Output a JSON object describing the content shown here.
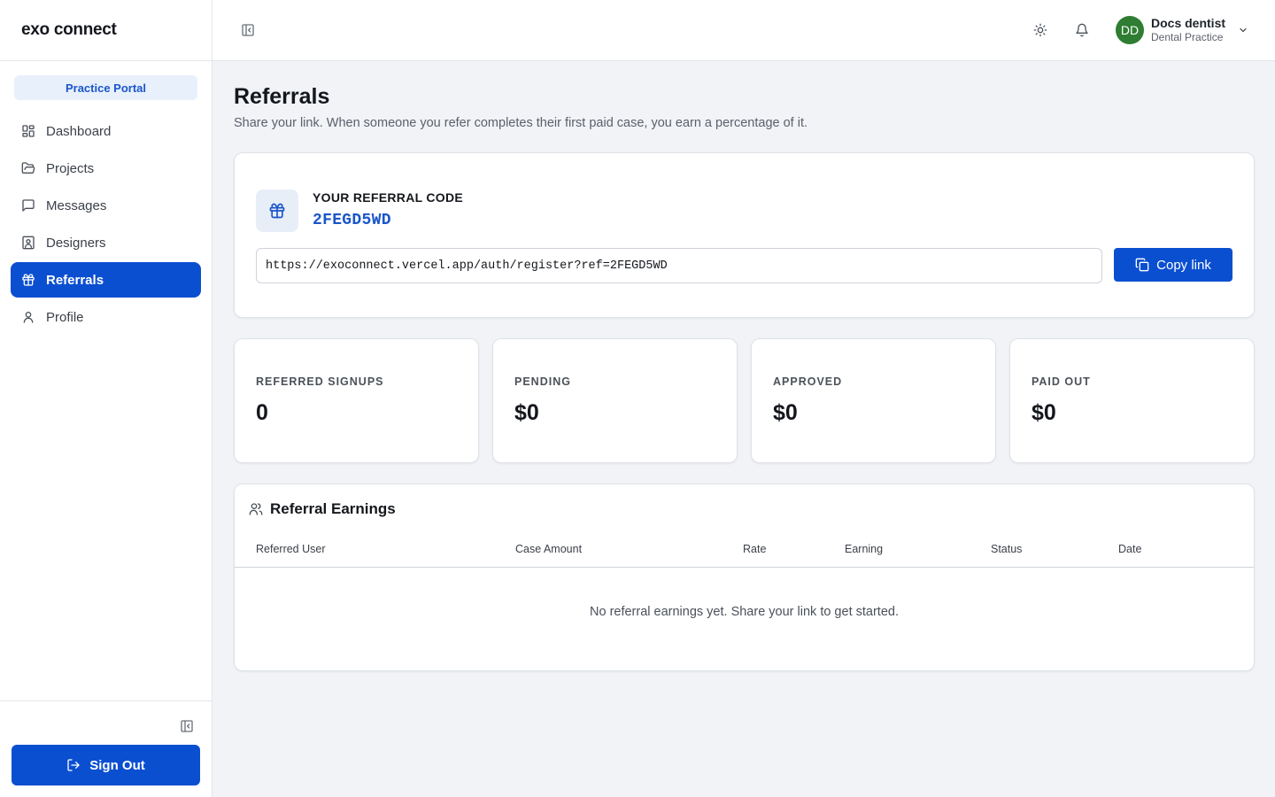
{
  "brand": {
    "name": "exo connect"
  },
  "sidebar": {
    "portal_label": "Practice Portal",
    "items": [
      {
        "label": "Dashboard",
        "icon": "layout-grid-icon",
        "active": false
      },
      {
        "label": "Projects",
        "icon": "folder-open-icon",
        "active": false
      },
      {
        "label": "Messages",
        "icon": "message-square-icon",
        "active": false
      },
      {
        "label": "Designers",
        "icon": "contact-icon",
        "active": false
      },
      {
        "label": "Referrals",
        "icon": "gift-icon",
        "active": true
      },
      {
        "label": "Profile",
        "icon": "user-icon",
        "active": false
      }
    ],
    "sign_out_label": "Sign Out"
  },
  "header": {
    "user": {
      "initials": "DD",
      "name": "Docs dentist",
      "role": "Dental Practice"
    }
  },
  "page": {
    "title": "Referrals",
    "subtitle": "Share your link. When someone you refer completes their first paid case, you earn a percentage of it."
  },
  "referral": {
    "code_label": "YOUR REFERRAL CODE",
    "code": "2FEGD5WD",
    "link": "https://exoconnect.vercel.app/auth/register?ref=2FEGD5WD",
    "copy_label": "Copy link"
  },
  "stats": [
    {
      "label": "REFERRED SIGNUPS",
      "value": "0"
    },
    {
      "label": "PENDING",
      "value": "$0"
    },
    {
      "label": "APPROVED",
      "value": "$0"
    },
    {
      "label": "PAID OUT",
      "value": "$0"
    }
  ],
  "earnings": {
    "title": "Referral Earnings",
    "columns": [
      "Referred User",
      "Case Amount",
      "Rate",
      "Earning",
      "Status",
      "Date"
    ],
    "rows": [],
    "empty_message": "No referral earnings yet. Share your link to get started."
  },
  "colors": {
    "accent": "#0b4fd1",
    "accent_text": "#1a56c9",
    "avatar": "#2e7d32",
    "background": "#f1f3f7"
  }
}
